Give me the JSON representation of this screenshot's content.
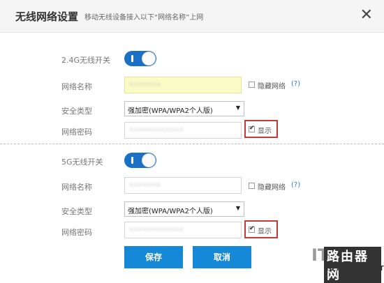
{
  "dialog": {
    "title": "无线网络设置",
    "subtitle": "移动无线设备接入以下“网络名称”上网",
    "close_glyph": "✕"
  },
  "band_24g": {
    "switch_label": "2.4G无线开关",
    "switch_on": true,
    "ssid_label": "网络名称",
    "ssid_value": "•••••••",
    "hide_label": "隐藏网络",
    "hide_checked": false,
    "help": "(?)",
    "security_label": "安全类型",
    "security_value": "强加密(WPA/WPA2个人版)",
    "password_label": "网络密码",
    "password_value": "••••••••••••",
    "show_label": "显示",
    "show_checked": true
  },
  "band_5g": {
    "switch_label": "5G无线开关",
    "switch_on": true,
    "ssid_label": "网络名称",
    "ssid_value": "•••••••",
    "hide_label": "隐藏网络",
    "hide_checked": false,
    "help": "(?)",
    "security_label": "安全类型",
    "security_value": "强加密(WPA/WPA2个人版)",
    "password_label": "网络密码",
    "password_value": "••••••••••••",
    "show_label": "显示",
    "show_checked": true
  },
  "actions": {
    "save_label": "保存",
    "cancel_label": "取消"
  },
  "watermark": {
    "it": "IT",
    "cn": "路由器网",
    "en": "LUYOUQI.NET"
  },
  "colors": {
    "accent": "#1589d8",
    "toggle": "#1a6fc7",
    "highlight_box": "#c0393b",
    "ssid_autofill": "#fbfbc6"
  }
}
